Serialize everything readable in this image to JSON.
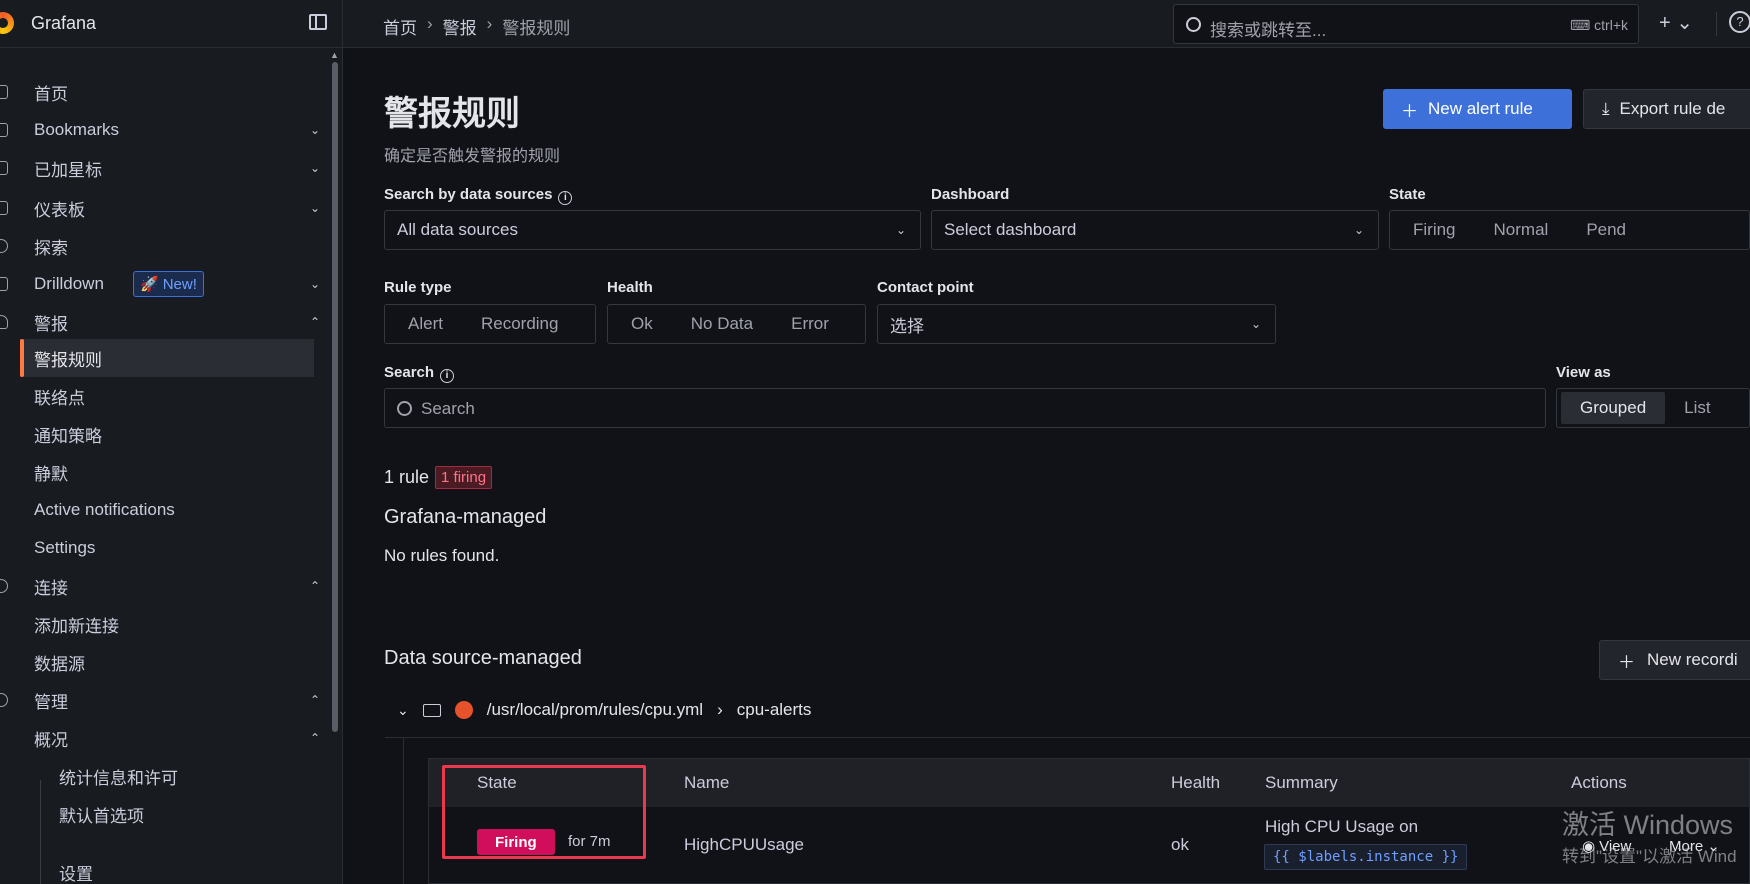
{
  "app": {
    "brand": "Grafana"
  },
  "sidebar": {
    "items": [
      {
        "label": "首页",
        "chevron": ""
      },
      {
        "label": "Bookmarks",
        "chevron": "⌄"
      },
      {
        "label": "已加星标",
        "chevron": "⌄"
      },
      {
        "label": "仪表板",
        "chevron": "⌄"
      },
      {
        "label": "探索",
        "chevron": ""
      },
      {
        "label": "Drilldown",
        "chevron": "⌄",
        "badge": "New!"
      },
      {
        "label": "警报",
        "chevron": "⌃"
      },
      {
        "label": "警报规则",
        "active": true
      },
      {
        "label": "联络点"
      },
      {
        "label": "通知策略"
      },
      {
        "label": "静默"
      },
      {
        "label": "Active notifications"
      },
      {
        "label": "Settings"
      },
      {
        "label": "连接",
        "chevron": "⌃"
      },
      {
        "label": "添加新连接"
      },
      {
        "label": "数据源"
      },
      {
        "label": "管理",
        "chevron": "⌃"
      },
      {
        "label": "概况",
        "chevron": "⌃"
      },
      {
        "label": "统计信息和许可"
      },
      {
        "label": "默认首选项"
      },
      {
        "label": "设置"
      }
    ]
  },
  "topbar": {
    "breadcrumbs": [
      "首页",
      "警报",
      "警报规则"
    ],
    "search_placeholder": "搜索或跳转至...",
    "search_shortcut": "ctrl+k",
    "plus": "+ ⌄",
    "help": "?"
  },
  "page": {
    "title": "警报规则",
    "subtitle": "确定是否触发警报的规则",
    "new_alert_rule": "New alert rule",
    "export_rule": "Export rule de"
  },
  "filters": {
    "datasource_label": "Search by data sources",
    "datasource_value": "All data sources",
    "dashboard_label": "Dashboard",
    "dashboard_placeholder": "Select dashboard",
    "state_label": "State",
    "state_options": [
      "Firing",
      "Normal",
      "Pend"
    ],
    "rule_type_label": "Rule type",
    "rule_type_options": [
      "Alert",
      "Recording"
    ],
    "health_label": "Health",
    "health_options": [
      "Ok",
      "No Data",
      "Error"
    ],
    "contact_point_label": "Contact point",
    "contact_point_placeholder": "选择",
    "search_label": "Search",
    "search_placeholder": "Search",
    "view_as_label": "View as",
    "view_as_options": [
      "Grouped",
      "List"
    ],
    "view_as_selected": "Grouped"
  },
  "summary": {
    "rule_count": "1 rule",
    "firing_badge": "1 firing"
  },
  "grafana_managed": {
    "title": "Grafana-managed",
    "empty": "No rules found."
  },
  "ds_managed": {
    "title": "Data source-managed",
    "new_recording": "New recordi",
    "namespace": "/usr/local/prom/rules/cpu.yml",
    "group": "cpu-alerts",
    "table": {
      "headers": [
        "State",
        "Name",
        "Health",
        "Summary",
        "Actions"
      ],
      "row": {
        "state": "Firing",
        "duration": "for 7m",
        "name": "HighCPUUsage",
        "health": "ok",
        "summary": "High CPU Usage on",
        "summary_code": "{{ $labels.instance }}",
        "action_view": "View",
        "action_more": "More"
      }
    }
  },
  "watermark": {
    "line1": "激活 Windows",
    "line2": "转到\"设置\"以激活 Wind"
  },
  "colors": {
    "primary": "#3d71d9",
    "firing": "#d10e5c",
    "accent": "#ff7941"
  }
}
